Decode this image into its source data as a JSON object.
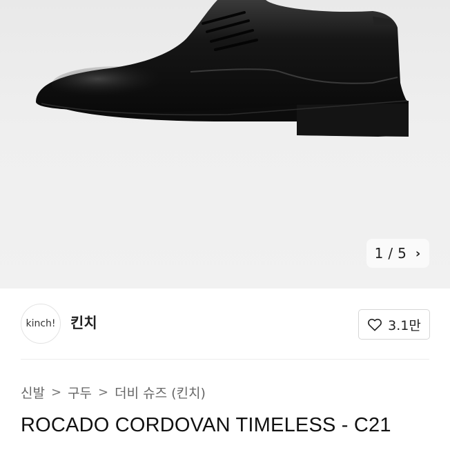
{
  "gallery": {
    "current": "1",
    "separator": "/",
    "total": "5",
    "next_icon": "chevron-right-icon"
  },
  "seller": {
    "logo_text": "kinch!",
    "name": "킨치"
  },
  "favorite": {
    "icon": "heart-outline-icon",
    "count": "3.1만"
  },
  "breadcrumb": {
    "items": [
      "신발",
      "구두",
      "더비 슈즈 (킨치)"
    ],
    "separator": ">"
  },
  "product": {
    "title": "ROCADO CORDOVAN TIMELESS - C21"
  }
}
